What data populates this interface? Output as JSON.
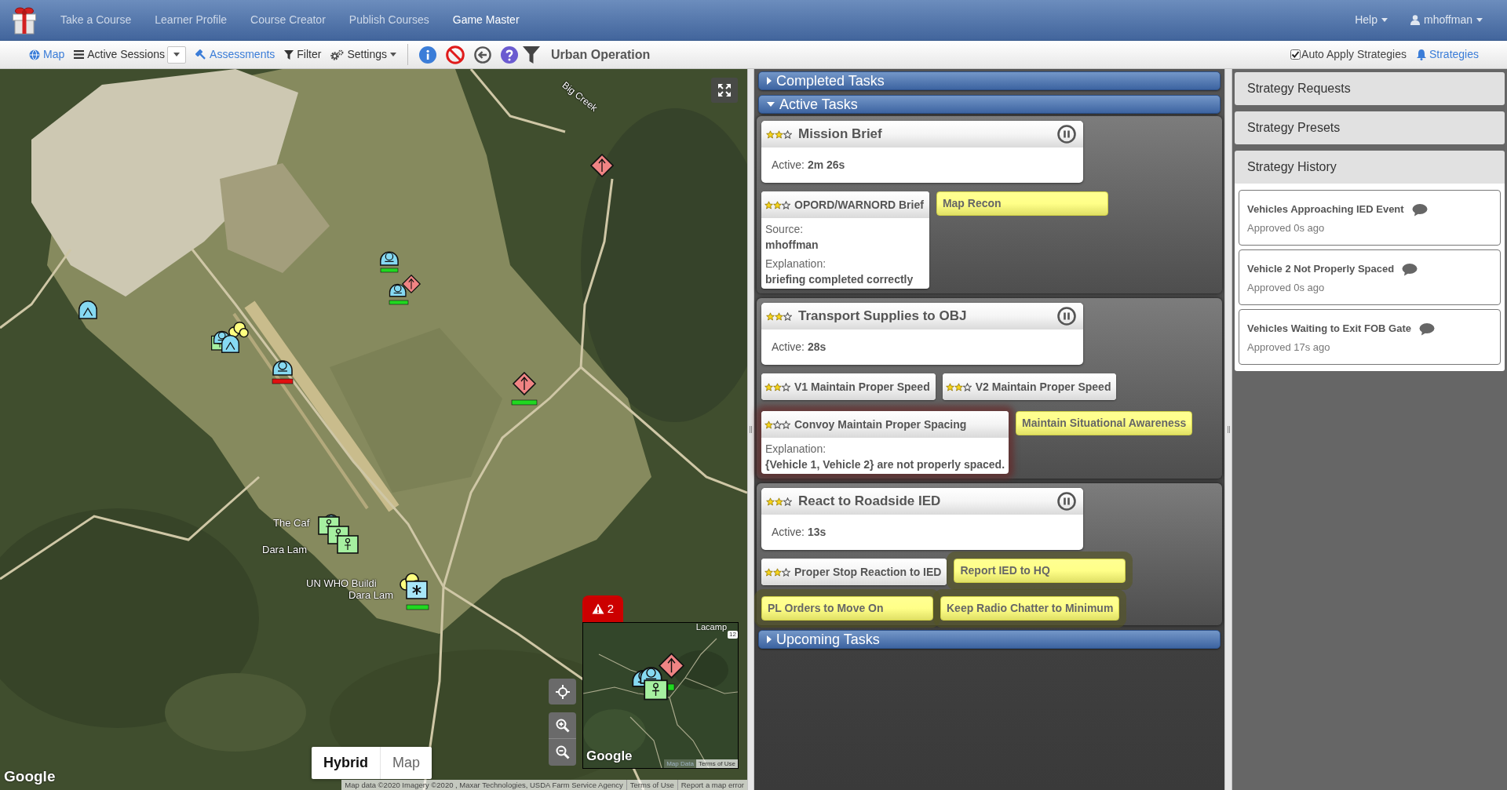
{
  "navbar": {
    "links": [
      {
        "label": "Take a Course",
        "selected": false
      },
      {
        "label": "Learner Profile",
        "selected": false
      },
      {
        "label": "Course Creator",
        "selected": false
      },
      {
        "label": "Publish Courses",
        "selected": false
      },
      {
        "label": "Game Master",
        "selected": true
      }
    ],
    "menus": [
      {
        "kind": "help",
        "label": "Help"
      },
      {
        "kind": "user",
        "label": "mhoffman"
      }
    ]
  },
  "toolbar": {
    "items": [
      {
        "kind": "map",
        "label": "Map"
      },
      {
        "kind": "sessions",
        "label": "Active Sessions"
      },
      {
        "kind": "assessments",
        "label": "Assessments"
      },
      {
        "kind": "filter",
        "label": "Filter"
      },
      {
        "kind": "settings",
        "label": "Settings"
      }
    ],
    "session_title": "Urban Operation",
    "auto_apply": {
      "label": "Auto Apply Strategies",
      "checked": true
    },
    "strategies_link": "Strategies"
  },
  "map": {
    "labels": [
      "Big Creek",
      "The Caf",
      "Dara Lam",
      "UN WHO Buildi",
      "Dara Lam"
    ],
    "view_types": [
      {
        "label": "Hybrid",
        "selected": true
      },
      {
        "label": "Map",
        "selected": false
      }
    ],
    "logo": "Google",
    "attribution": [
      "Map data ©2020 Imagery ©2020 , Maxar Technologies, USDA Farm Service Agency",
      "Terms of Use",
      "Report a map error"
    ],
    "alert_count": "2",
    "minimap": {
      "place_label": "Lacamp",
      "road_number": "12",
      "logo": "Google",
      "attribution": [
        "Map Data",
        "Terms of Use"
      ]
    }
  },
  "tasks": {
    "sections": [
      {
        "title": "Completed Tasks",
        "expanded": false
      },
      {
        "title": "Active Tasks",
        "expanded": true,
        "tasks": [
          {
            "title": "Mission Brief",
            "stars": 2,
            "status": "Active: **2m 26s**",
            "concepts": [
              {
                "kind": "assessed",
                "title": "OPORD/WARNORD Brief",
                "stars": 2,
                "flagged": false,
                "details": [
                  {
                    "label": "Source:",
                    "value": "mhoffman"
                  },
                  {
                    "label": "Explanation:",
                    "value": "briefing completed correctly"
                  }
                ]
              },
              {
                "kind": "pending",
                "title": "Map Recon",
                "flagged": false
              }
            ]
          },
          {
            "title": "Transport Supplies to OBJ",
            "stars": 2,
            "status": "Active: **28s**",
            "concepts": [
              {
                "kind": "assessed",
                "title": "V1 Maintain Proper Speed",
                "stars": 2,
                "flagged": false
              },
              {
                "kind": "assessed",
                "title": "V2 Maintain Proper Speed",
                "stars": 2,
                "flagged": false
              },
              {
                "kind": "assessed",
                "title": "Convoy Maintain Proper Spacing",
                "stars": 1,
                "flagged": true,
                "details": [
                  {
                    "label": "Explanation:",
                    "value": "{Vehicle 1, Vehicle 2} are not properly spaced."
                  }
                ]
              },
              {
                "kind": "pending",
                "title": "Maintain Situational Awareness",
                "flagged": false
              }
            ]
          },
          {
            "title": "React to Roadside IED",
            "stars": 2,
            "status": "Active: **13s**",
            "concepts": [
              {
                "kind": "assessed",
                "title": "Proper Stop Reaction to IED",
                "stars": 2,
                "flagged": false
              },
              {
                "kind": "pending",
                "title": "Report IED to HQ",
                "flagged": true
              },
              {
                "kind": "pending",
                "title": "PL Orders to Move On",
                "flagged": true
              },
              {
                "kind": "pending",
                "title": "Keep Radio Chatter to Minimum",
                "flagged": true
              }
            ]
          }
        ]
      },
      {
        "title": "Upcoming Tasks",
        "expanded": false
      }
    ]
  },
  "strategies": {
    "sections": [
      {
        "title": "Strategy Requests",
        "expanded": false
      },
      {
        "title": "Strategy Presets",
        "expanded": false
      },
      {
        "title": "Strategy History",
        "expanded": true,
        "items": [
          {
            "title": "Vehicles Approaching IED Event",
            "time": "Approved 0s ago"
          },
          {
            "title": "Vehicle 2 Not Properly Spaced",
            "time": "Approved 0s ago"
          },
          {
            "title": "Vehicles Waiting to Exit FOB Gate",
            "time": "Approved 17s ago"
          }
        ]
      }
    ]
  }
}
